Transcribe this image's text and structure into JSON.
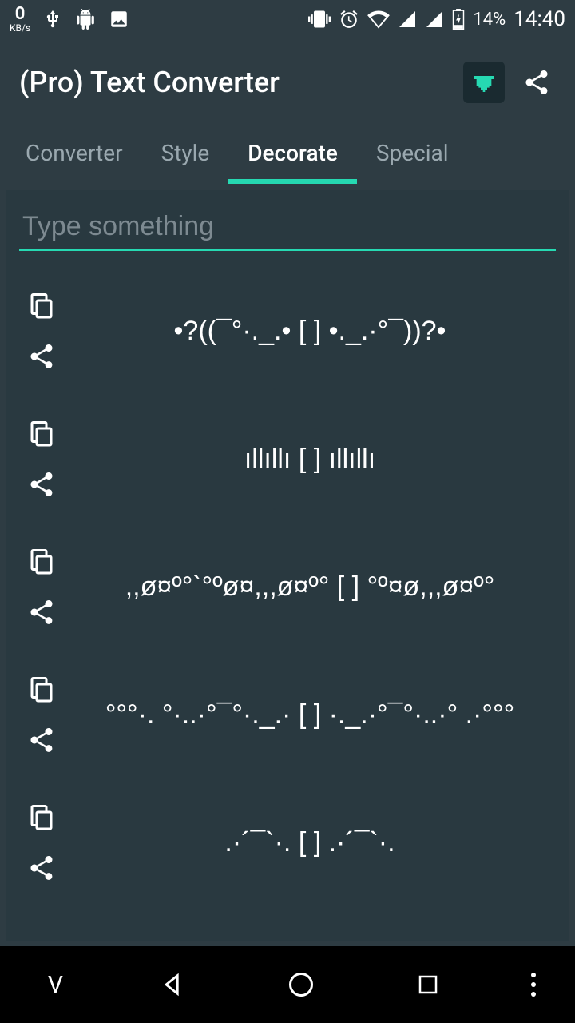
{
  "status": {
    "kbs_value": "0",
    "kbs_unit": "KB/s",
    "battery": "14%",
    "time": "14:40"
  },
  "header": {
    "title": "(Pro) Text Converter"
  },
  "tabs": [
    {
      "label": "Converter",
      "active": false
    },
    {
      "label": "Style",
      "active": false
    },
    {
      "label": "Decorate",
      "active": true
    },
    {
      "label": "Special",
      "active": false
    }
  ],
  "input": {
    "placeholder": "Type something",
    "value": ""
  },
  "results": [
    {
      "text": "•?((¯°·._.• [ ] •._.·°¯))?•"
    },
    {
      "text": "ıllıllı [ ] ıllıllı"
    },
    {
      "text": ",,ø¤º°`°ºø¤,,,ø¤º° [ ] °º¤ø,,,ø¤º°"
    },
    {
      "text": "°°°·. °·..·°¯°·._.· [ ] ·._.·°¯°·..·° .·°°°"
    },
    {
      "text": ".·´¯`·. [ ] .·´¯`·."
    }
  ]
}
